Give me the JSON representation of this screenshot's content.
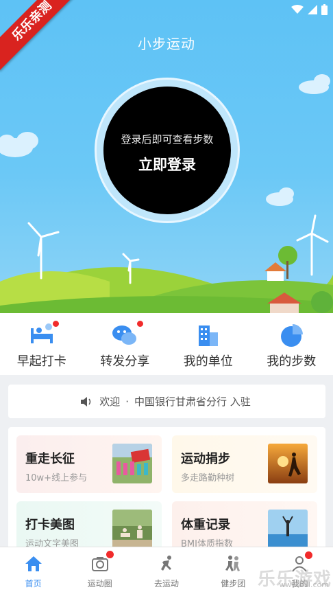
{
  "app": {
    "title": "小步运动"
  },
  "badge": {
    "ribbon_text": "乐乐亲测"
  },
  "login_circle": {
    "hint": "登录后即可查看步数",
    "action": "立即登录"
  },
  "quick_actions": [
    {
      "label": "早起打卡",
      "icon": "bed-checkin-icon",
      "dot": true
    },
    {
      "label": "转发分享",
      "icon": "wechat-icon",
      "dot": true
    },
    {
      "label": "我的单位",
      "icon": "building-icon",
      "dot": false
    },
    {
      "label": "我的步数",
      "icon": "pie-chart-icon",
      "dot": false
    }
  ],
  "notice": {
    "icon": "speaker-icon",
    "prefix": "欢迎",
    "separator": "·",
    "text": "中国银行甘肃省分行 入驻"
  },
  "cards": [
    {
      "title": "重走长征",
      "subtitle": "10w+线上参与"
    },
    {
      "title": "运动捐步",
      "subtitle": "多走路勤种树"
    },
    {
      "title": "打卡美图",
      "subtitle": "运动文字美图"
    },
    {
      "title": "体重记录",
      "subtitle": "BMI体质指数"
    }
  ],
  "tabs": [
    {
      "label": "首页",
      "icon": "home-icon",
      "active": true,
      "dot": false
    },
    {
      "label": "运动圈",
      "icon": "camera-icon",
      "active": false,
      "dot": true
    },
    {
      "label": "去运动",
      "icon": "runner-icon",
      "active": false,
      "dot": false
    },
    {
      "label": "健步团",
      "icon": "group-walk-icon",
      "active": false,
      "dot": false
    },
    {
      "label": "我的",
      "icon": "user-icon",
      "active": false,
      "dot": true
    }
  ],
  "watermark": {
    "text": "乐乐游戏",
    "url": "www.6lll.com"
  },
  "colors": {
    "sky": "#5ec2f5",
    "accent": "#3a8ef0",
    "red_dot": "#f12b2b",
    "ribbon": "#d9231f"
  }
}
